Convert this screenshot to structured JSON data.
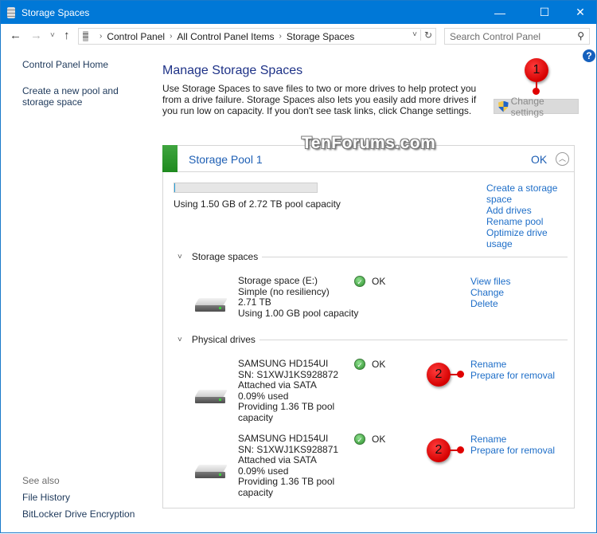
{
  "window": {
    "title": "Storage Spaces",
    "controls": {
      "minimize": "—",
      "maximize": "☐",
      "close": "✕"
    }
  },
  "nav": {
    "back": "←",
    "forward": "→",
    "recent": "˅",
    "up": "↑",
    "breadcrumb": [
      "Control Panel",
      "All Control Panel Items",
      "Storage Spaces"
    ],
    "separator": "›",
    "dropdown": "˅",
    "refresh": "↻",
    "search_placeholder": "Search Control Panel",
    "search_icon": "⚲"
  },
  "sidebar": {
    "links": [
      "Control Panel Home",
      "Create a new pool and storage space"
    ],
    "see_also_label": "See also",
    "see_also": [
      "File History",
      "BitLocker Drive Encryption"
    ]
  },
  "help": "?",
  "main": {
    "title": "Manage Storage Spaces",
    "description": "Use Storage Spaces to save files to two or more drives to help protect you from a drive failure. Storage Spaces also lets you easily add more drives if you run low on capacity. If you don't see task links, click Change settings.",
    "change_settings": "Change settings"
  },
  "annotations": {
    "badge1": "1",
    "badge2": "2"
  },
  "watermark": "TenForums.com",
  "pool": {
    "name": "Storage Pool 1",
    "status": "OK",
    "status_color": "#2a9a2a",
    "collapse_icon": "︿",
    "usage_fraction": 0.0005,
    "capacity_text": "Using 1.50 GB of 2.72 TB pool capacity",
    "actions": [
      "Create a storage space",
      "Add drives",
      "Rename pool",
      "Optimize drive usage"
    ],
    "storage_spaces_label": "Storage spaces",
    "physical_drives_label": "Physical drives",
    "chevron": "˅",
    "space": {
      "lines": [
        "Storage space (E:)",
        "Simple (no resiliency)",
        "2.71 TB",
        "Using 1.00 GB pool capacity"
      ],
      "status": "OK",
      "actions": [
        "View files",
        "Change",
        "Delete"
      ]
    },
    "drives": [
      {
        "lines": [
          "SAMSUNG HD154UI",
          "SN: S1XWJ1KS928872",
          "Attached via SATA",
          "0.09% used",
          "Providing 1.36 TB pool",
          "capacity"
        ],
        "status": "OK",
        "actions": [
          "Rename",
          "Prepare for removal"
        ]
      },
      {
        "lines": [
          "SAMSUNG HD154UI",
          "SN: S1XWJ1KS928871",
          "Attached via SATA",
          "0.09% used",
          "Providing 1.36 TB pool",
          "capacity"
        ],
        "status": "OK",
        "actions": [
          "Rename",
          "Prepare for removal"
        ]
      }
    ]
  }
}
